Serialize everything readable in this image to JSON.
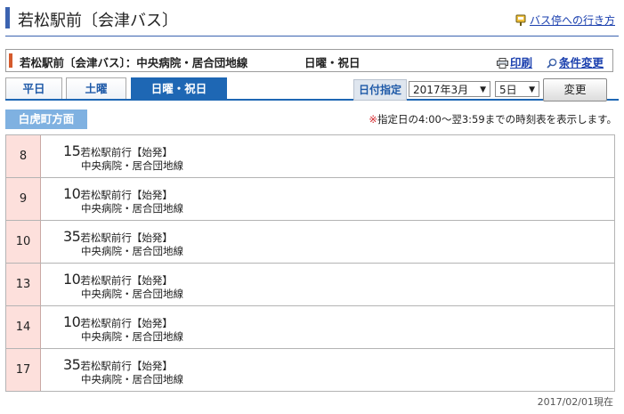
{
  "header": {
    "title": "若松駅前〔会津バス〕",
    "bus_stop_link": "バス停への行き方"
  },
  "info": {
    "route": "若松駅前〔会津バス〕：中央病院・居合団地線",
    "day_type": "日曜・祝日",
    "print_label": "印刷",
    "change_conditions_label": "条件変更"
  },
  "tabs": [
    {
      "label": "平日",
      "active": false
    },
    {
      "label": "土曜",
      "active": false
    },
    {
      "label": "日曜・祝日",
      "active": true
    }
  ],
  "date_select": {
    "label": "日付指定",
    "month": "2017年3月",
    "day": "5日",
    "change_button": "変更"
  },
  "direction": "白虎町方面",
  "note": {
    "mark": "※",
    "text": "指定日の4:00〜翌3:59までの時刻表を表示します。"
  },
  "timetable": [
    {
      "hour": "8",
      "minute": "15",
      "destination": "若松駅前行【始発】",
      "line": "中央病院・居合団地線"
    },
    {
      "hour": "9",
      "minute": "10",
      "destination": "若松駅前行【始発】",
      "line": "中央病院・居合団地線"
    },
    {
      "hour": "10",
      "minute": "35",
      "destination": "若松駅前行【始発】",
      "line": "中央病院・居合団地線"
    },
    {
      "hour": "13",
      "minute": "10",
      "destination": "若松駅前行【始発】",
      "line": "中央病院・居合団地線"
    },
    {
      "hour": "14",
      "minute": "10",
      "destination": "若松駅前行【始発】",
      "line": "中央病院・居合団地線"
    },
    {
      "hour": "17",
      "minute": "35",
      "destination": "若松駅前行【始発】",
      "line": "中央病院・居合団地線"
    }
  ],
  "as_of": "2017/02/01現在",
  "colors": {
    "accent_blue": "#1e67b4",
    "hour_bg": "#fde0dc",
    "direction_bg": "#7fb1e1",
    "link": "#1a3fae"
  }
}
